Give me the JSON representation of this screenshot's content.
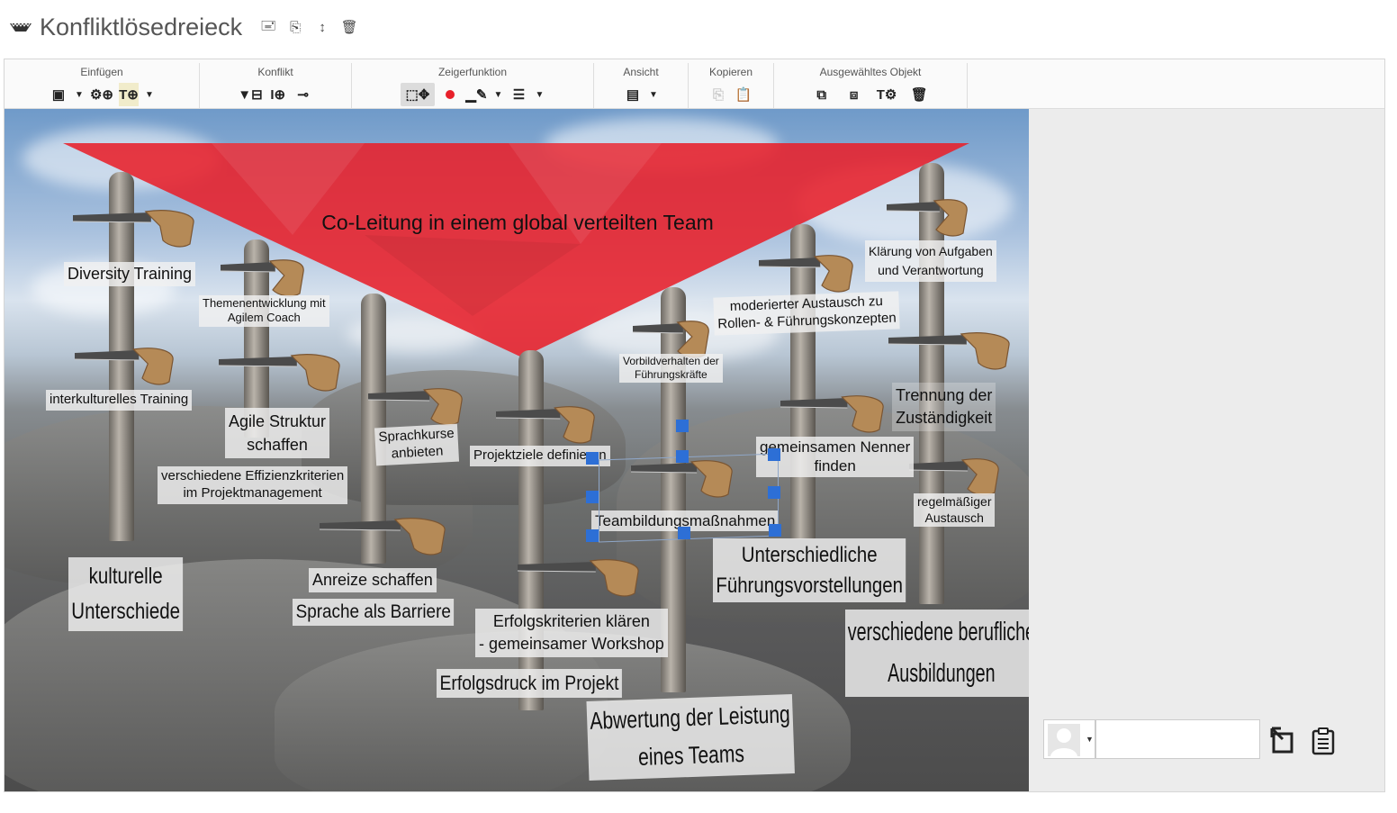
{
  "title": "Konfliktlösedreieck",
  "title_buttons": [
    {
      "icon": "rename-icon",
      "glyph": "🖃"
    },
    {
      "icon": "copy-icon",
      "glyph": "⎘"
    },
    {
      "icon": "sort-icon",
      "glyph": "↕"
    },
    {
      "icon": "delete-icon",
      "glyph": "🗑"
    }
  ],
  "toolbar": {
    "groups": [
      {
        "label": "Einfügen"
      },
      {
        "label": "Konflikt"
      },
      {
        "label": "Zeigerfunktion"
      },
      {
        "label": "Ansicht"
      },
      {
        "label": "Kopieren"
      },
      {
        "label": "Ausgewähltes Objekt"
      }
    ]
  },
  "canvas": {
    "triangle_label": "Co-Leitung in einem global verteilten Team",
    "labels": [
      {
        "id": "diversity",
        "text": "Diversity Training"
      },
      {
        "id": "themen1",
        "text": "Themenentwicklung mit"
      },
      {
        "id": "themen2",
        "text": "Agilem Coach"
      },
      {
        "id": "interkult",
        "text": "interkulturelles Training"
      },
      {
        "id": "agile1",
        "text": "Agile Struktur"
      },
      {
        "id": "agile2",
        "text": "schaffen"
      },
      {
        "id": "sprachk1",
        "text": "Sprachkurse"
      },
      {
        "id": "sprachk2",
        "text": "anbieten"
      },
      {
        "id": "effiz1",
        "text": "verschiedene Effizienzkriterien"
      },
      {
        "id": "effiz2",
        "text": "im Projektmanagement"
      },
      {
        "id": "kult1",
        "text": "kulturelle"
      },
      {
        "id": "kult2",
        "text": "Unterschiede"
      },
      {
        "id": "anreize",
        "text": "Anreize schaffen"
      },
      {
        "id": "sprache",
        "text": "Sprache als Barriere"
      },
      {
        "id": "projektziele",
        "text": "Projektziele definieren"
      },
      {
        "id": "erfolgk1",
        "text": "Erfolgskriterien klären"
      },
      {
        "id": "erfolgk2",
        "text": "- gemeinsamer Workshop"
      },
      {
        "id": "erfolgsdruck",
        "text": "Erfolgsdruck im Projekt"
      },
      {
        "id": "vorbild1",
        "text": "Vorbildverhalten der"
      },
      {
        "id": "vorbild2",
        "text": "Führungskräfte"
      },
      {
        "id": "teambild",
        "text": "Teambildungsmaßnahmen"
      },
      {
        "id": "abwertung1",
        "text": "Abwertung der Leistung"
      },
      {
        "id": "abwertung2",
        "text": "eines Teams"
      },
      {
        "id": "moder1",
        "text": "moderierter Austausch zu"
      },
      {
        "id": "moder2",
        "text": "Rollen- & Führungskonzepten"
      },
      {
        "id": "nenner1",
        "text": "gemeinsamen Nenner"
      },
      {
        "id": "nenner2",
        "text": "finden"
      },
      {
        "id": "unter1",
        "text": "Unterschiedliche"
      },
      {
        "id": "unter2",
        "text": "Führungsvorstellungen"
      },
      {
        "id": "klaer1",
        "text": "Klärung von Aufgaben"
      },
      {
        "id": "klaer2",
        "text": "und Verantwortung"
      },
      {
        "id": "trenn1",
        "text": "Trennung der"
      },
      {
        "id": "trenn2",
        "text": "Zuständigkeit"
      },
      {
        "id": "regel1",
        "text": "regelmäßiger"
      },
      {
        "id": "regel2",
        "text": "Austausch"
      },
      {
        "id": "beruf1",
        "text": "verschiedene berufliche"
      },
      {
        "id": "beruf2",
        "text": "Ausbildungen"
      }
    ]
  },
  "colors": {
    "triangle": "#e8202a",
    "selection": "#2d6fd6"
  }
}
